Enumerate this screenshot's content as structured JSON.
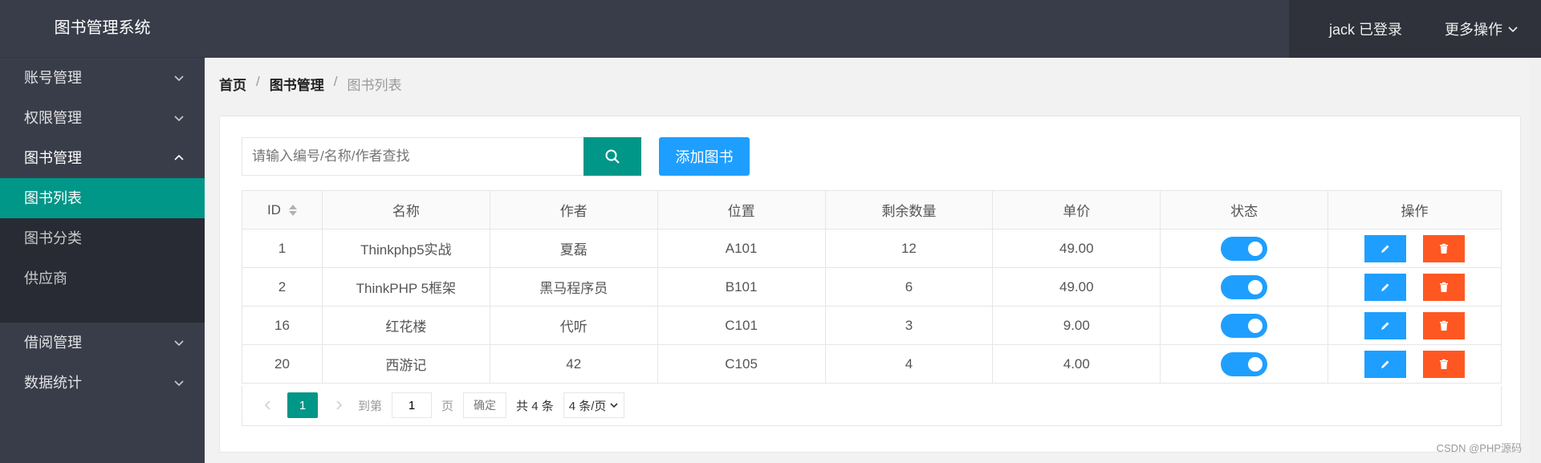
{
  "app": {
    "title": "图书管理系统"
  },
  "header": {
    "user": "jack 已登录",
    "more": "更多操作"
  },
  "sidebar": {
    "items": [
      {
        "label": "账号管理"
      },
      {
        "label": "权限管理"
      },
      {
        "label": "图书管理"
      }
    ],
    "sub": [
      {
        "label": "图书列表"
      },
      {
        "label": "图书分类"
      },
      {
        "label": "供应商"
      }
    ],
    "items2": [
      {
        "label": "借阅管理"
      },
      {
        "label": "数据统计"
      }
    ]
  },
  "breadcrumb": [
    "首页",
    "图书管理",
    "图书列表"
  ],
  "search": {
    "placeholder": "请输入编号/名称/作者查找"
  },
  "add_label": "添加图书",
  "table": {
    "headers": [
      "ID",
      "名称",
      "作者",
      "位置",
      "剩余数量",
      "单价",
      "状态",
      "操作"
    ],
    "rows": [
      {
        "id": "1",
        "name": "Thinkphp5实战",
        "author": "夏磊",
        "loc": "A101",
        "qty": "12",
        "price": "49.00",
        "status": true
      },
      {
        "id": "2",
        "name": "ThinkPHP 5框架",
        "author": "黑马程序员",
        "loc": "B101",
        "qty": "6",
        "price": "49.00",
        "status": true
      },
      {
        "id": "16",
        "name": "红花楼",
        "author": "代听",
        "loc": "C101",
        "qty": "3",
        "price": "9.00",
        "status": true
      },
      {
        "id": "20",
        "name": "西游记",
        "author": "42",
        "loc": "C105",
        "qty": "4",
        "price": "4.00",
        "status": true
      }
    ]
  },
  "pager": {
    "current": "1",
    "goto": "到第",
    "input": "1",
    "page": "页",
    "confirm": "确定",
    "total": "共 4 条",
    "size": "4 条/页"
  },
  "watermark": "CSDN @PHP源码",
  "colors": {
    "primary": "#009688",
    "blue": "#1e9fff",
    "danger": "#ff5722",
    "dark": "#393d49"
  }
}
